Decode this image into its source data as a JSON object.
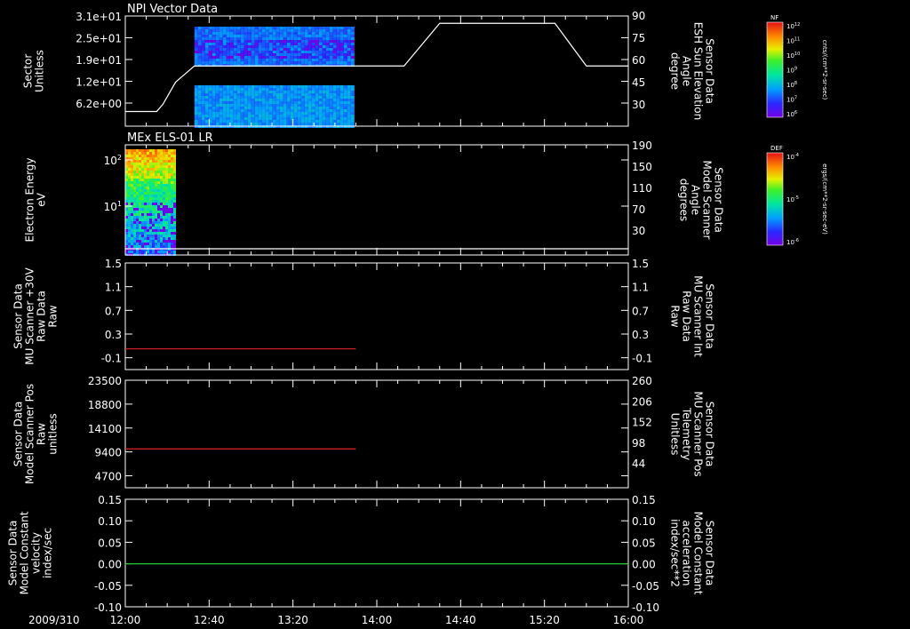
{
  "date": "2009/310",
  "colors": {
    "background": "#000000",
    "axis": "#ffffff",
    "red_trace": "#e0242a",
    "green_trace": "#25c93a",
    "white_trace": "#ffffff"
  },
  "chart_data": [
    {
      "type": "heatmap",
      "title": "NPI Vector Data",
      "y_ticks": [
        "3.1e+01",
        "2.5e+01",
        "1.9e+01",
        "1.2e+01",
        "6.2e+00"
      ],
      "ylabel": [
        "Sector",
        "Unitless"
      ],
      "y2_ticks": [
        "90",
        "75",
        "60",
        "45",
        "30"
      ],
      "y2label": [
        "Sensor Data",
        "ESH Sun Elevation",
        "Angle",
        "degree"
      ],
      "y2lim": [
        15,
        90
      ],
      "overlay_line": {
        "x": [
          "12:00",
          "12:15",
          "12:18",
          "12:24",
          "12:33",
          "14:00",
          "14:13",
          "14:30",
          "15:25",
          "15:40",
          "16:00"
        ],
        "y": [
          25,
          25,
          30,
          45,
          56,
          56,
          56,
          85,
          85,
          56,
          56
        ]
      },
      "data_extent_x": [
        "12:33",
        "13:48"
      ],
      "colorbar": {
        "label": "NF",
        "unit": "cnts/(cm**2-sr-sec)",
        "ticks": [
          "10^12",
          "10^11",
          "10^10",
          "10^9",
          "10^8",
          "10^7",
          "10^6"
        ]
      }
    },
    {
      "type": "heatmap",
      "title": "MEx ELS-01 LR",
      "y_ticks": [
        "10^2",
        "10^1"
      ],
      "ylabel": [
        "Electron Energy",
        "eV"
      ],
      "y2_ticks": [
        "190",
        "150",
        "110",
        "70",
        "30"
      ],
      "y2label": [
        "Sensor Data",
        "Model Scanner",
        "Angle",
        "degrees"
      ],
      "y2lim": [
        -5,
        190
      ],
      "overlay_line": {
        "x": [
          "12:00",
          "16:00"
        ],
        "y": [
          6,
          6
        ]
      },
      "data_extent_x": [
        "12:00",
        "12:24"
      ],
      "colorbar": {
        "label": "DEF",
        "unit": "ergs/(cm**2-sr-sec-eV)",
        "ticks": [
          "10^-4",
          "10^-5",
          "10^-6"
        ]
      }
    },
    {
      "type": "line",
      "y_ticks": [
        "1.5",
        "1.1",
        "0.7",
        "0.3",
        "-0.1"
      ],
      "ylim": [
        -0.3,
        1.5
      ],
      "ylabel": [
        "Sensor Data",
        "MU Scanner +30V",
        "Raw Data",
        "Raw"
      ],
      "y2_ticks": [
        "1.5",
        "1.1",
        "0.7",
        "0.3",
        "-0.1"
      ],
      "y2label": [
        "Sensor Data",
        "MU Scanner Int",
        "Raw Data",
        "Raw"
      ],
      "series": [
        {
          "x": [
            "12:00",
            "13:50"
          ],
          "y": [
            0.05,
            0.05
          ],
          "color": "red"
        }
      ]
    },
    {
      "type": "line",
      "y_ticks": [
        "23500",
        "18800",
        "14100",
        "9400",
        "4700"
      ],
      "ylim": [
        0,
        23500
      ],
      "ylabel": [
        "Sensor Data",
        "Model Scanner Pos",
        "Raw",
        "unitless"
      ],
      "y2_ticks": [
        "260",
        "206",
        "152",
        "98",
        "44"
      ],
      "y2label": [
        "Sensor Data",
        "MU Scanner Pos",
        "Telemetry",
        "Unitless"
      ],
      "series": [
        {
          "x": [
            "12:00",
            "13:50"
          ],
          "y": [
            8500,
            8500
          ],
          "color": "red"
        }
      ]
    },
    {
      "type": "line",
      "y_ticks": [
        "0.15",
        "0.10",
        "0.05",
        "0.00",
        "-0.05",
        "-0.10"
      ],
      "ylim": [
        -0.1,
        0.15
      ],
      "ylabel": [
        "Sensor Data",
        "Model Constant",
        "velocity",
        "index/sec"
      ],
      "y2_ticks": [
        "0.15",
        "0.10",
        "0.05",
        "0.00",
        "-0.05",
        "-0.10"
      ],
      "y2label": [
        "Sensor Data",
        "Model Constant",
        "acceleration",
        "index/sec**2"
      ],
      "series": [
        {
          "x": [
            "12:00",
            "16:00"
          ],
          "y": [
            0.0,
            0.0
          ],
          "color": "green"
        }
      ]
    }
  ],
  "x_axis": {
    "ticks": [
      "12:00",
      "12:40",
      "13:20",
      "14:00",
      "14:40",
      "15:20",
      "16:00"
    ],
    "range": [
      "12:00",
      "16:00"
    ]
  }
}
